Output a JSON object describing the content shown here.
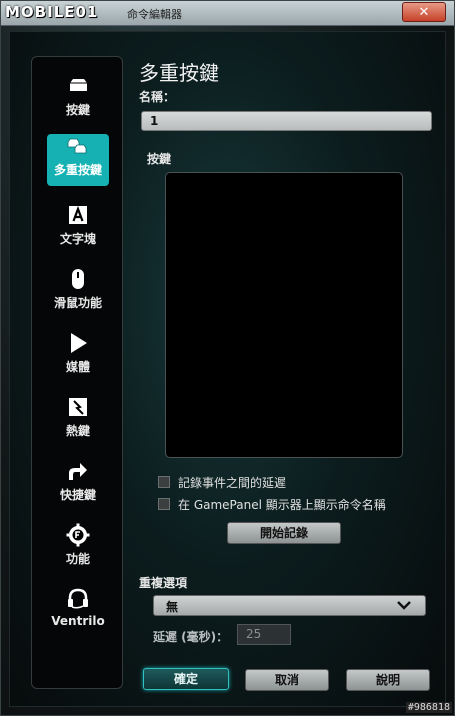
{
  "window": {
    "logo": "MOBILE01",
    "title": "命令編輯器",
    "close_label": "✕"
  },
  "sidebar": {
    "items": [
      {
        "label": "按鍵",
        "icon": "key-icon"
      },
      {
        "label": "多重按鍵",
        "icon": "multi-key-icon",
        "active": true
      },
      {
        "label": "文字塊",
        "icon": "text-block-icon"
      },
      {
        "label": "滑鼠功能",
        "icon": "mouse-icon"
      },
      {
        "label": "媒體",
        "icon": "play-icon"
      },
      {
        "label": "熱鍵",
        "icon": "hotkey-icon"
      },
      {
        "label": "快捷鍵",
        "icon": "shortcut-arrow-icon"
      },
      {
        "label": "功能",
        "icon": "function-gear-icon"
      },
      {
        "label": "Ventrilo",
        "icon": "headset-icon"
      }
    ]
  },
  "main": {
    "heading": "多重按鍵",
    "name_label": "名稱：",
    "name_value": "1",
    "keys_label": "按鍵",
    "checkbox_delay": "記錄事件之間的延遲",
    "checkbox_gamepanel": "在 GamePanel 顯示器上顯示命令名稱",
    "record_button": "開始記錄",
    "repeat_label": "重複選項",
    "repeat_value": "無",
    "delay_label": "延遲 (毫秒)：",
    "delay_value": "25"
  },
  "footer": {
    "ok": "確定",
    "cancel": "取消",
    "help": "說明"
  },
  "watermark": "#986818",
  "colors": {
    "accent": "#16b1b3",
    "close": "#c64128"
  }
}
